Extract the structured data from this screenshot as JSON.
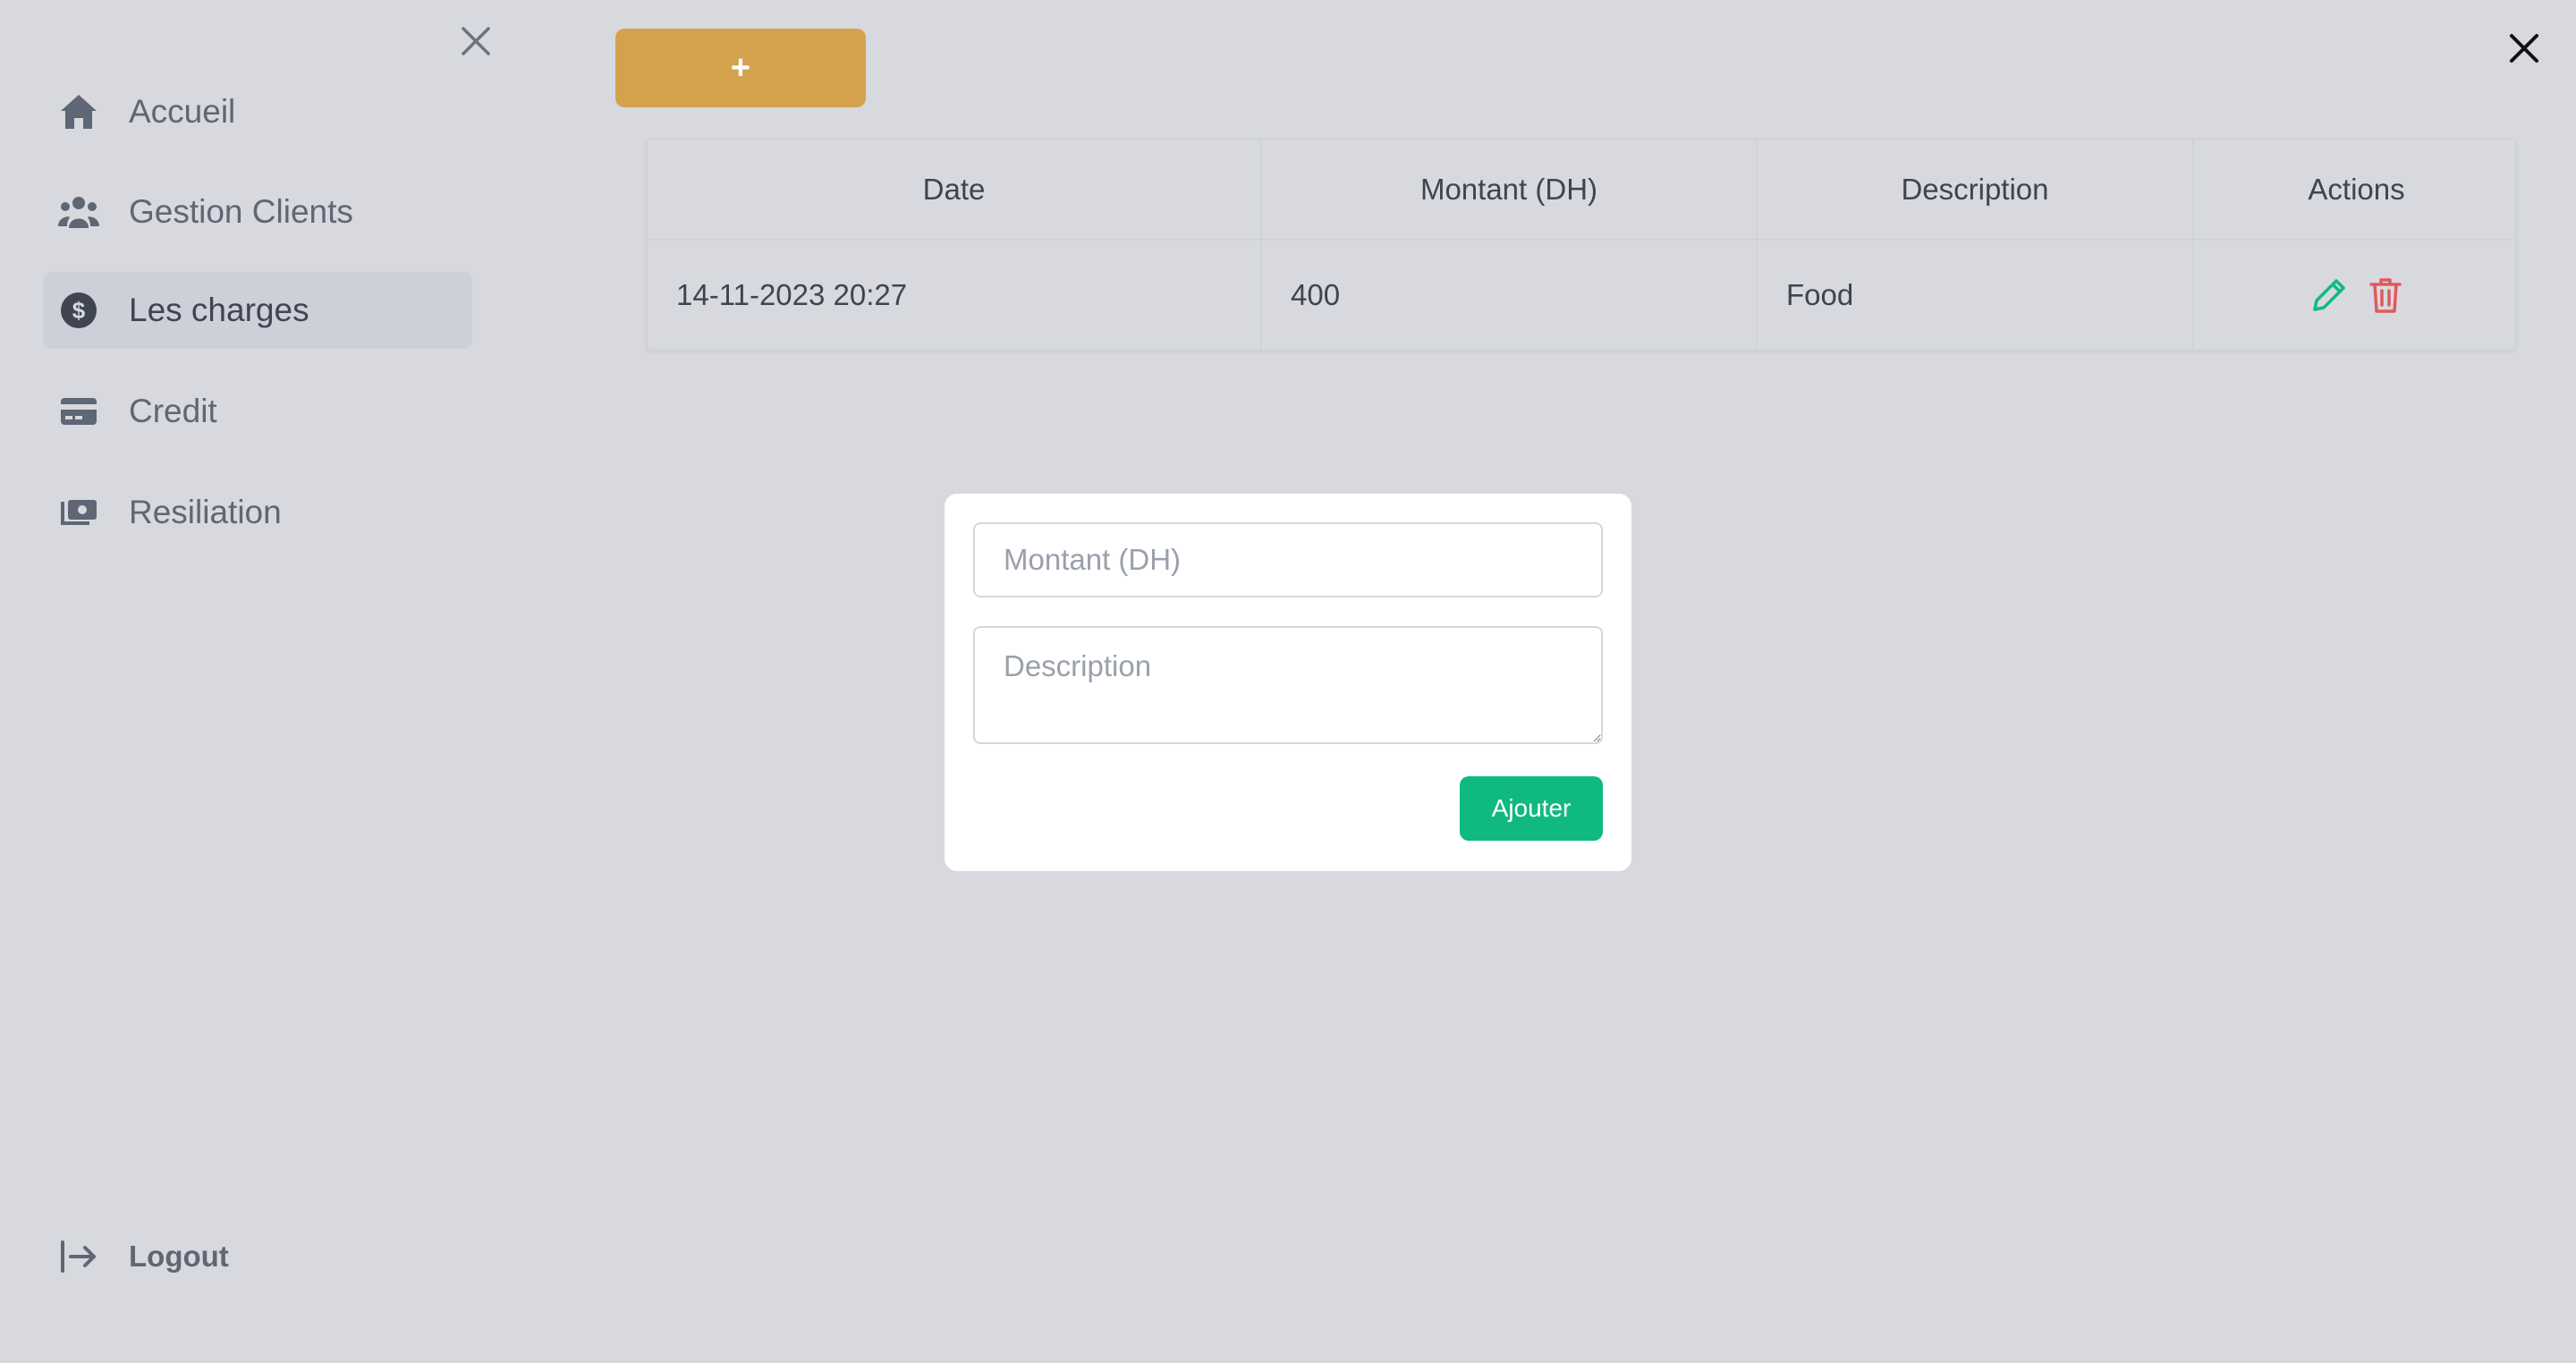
{
  "sidebar": {
    "items": [
      {
        "label": "Accueil",
        "icon": "home-icon"
      },
      {
        "label": "Gestion Clients",
        "icon": "users-icon"
      },
      {
        "label": "Les charges",
        "icon": "dollar-circle-icon",
        "active": true
      },
      {
        "label": "Credit",
        "icon": "credit-card-icon"
      },
      {
        "label": "Resiliation",
        "icon": "money-bill-icon"
      }
    ],
    "logout_label": "Logout"
  },
  "toolbar": {
    "add_label": "+"
  },
  "table": {
    "headers": [
      "Date",
      "Montant (DH)",
      "Description",
      "Actions"
    ],
    "rows": [
      {
        "date": "14-11-2023 20:27",
        "montant": "400",
        "description": "Food"
      }
    ]
  },
  "modal": {
    "montant_placeholder": "Montant (DH)",
    "description_placeholder": "Description",
    "submit_label": "Ajouter"
  },
  "colors": {
    "accent_add": "#d4a24d",
    "submit": "#10b981",
    "edit": "#10b981",
    "delete": "#e05a5a"
  }
}
